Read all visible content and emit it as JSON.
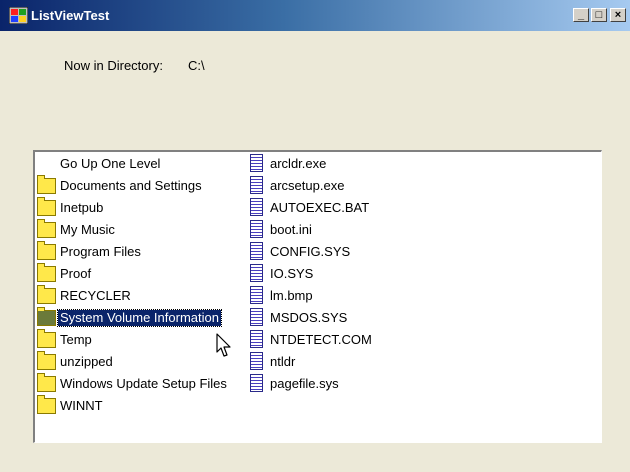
{
  "window": {
    "title": "ListViewTest",
    "controls": [
      "_",
      "□",
      "×"
    ]
  },
  "directory": {
    "label": "Now in Directory:",
    "value": "C:\\"
  },
  "list": {
    "left_column": [
      {
        "label": "Go Up One Level",
        "icon": "none"
      },
      {
        "label": "Documents and Settings",
        "icon": "folder-icon"
      },
      {
        "label": "Inetpub",
        "icon": "folder-icon"
      },
      {
        "label": "My Music",
        "icon": "folder-icon"
      },
      {
        "label": "Program Files",
        "icon": "folder-icon"
      },
      {
        "label": "Proof",
        "icon": "folder-icon"
      },
      {
        "label": "RECYCLER",
        "icon": "folder-icon"
      },
      {
        "label": "System Volume Information",
        "icon": "folder-icon",
        "selected": true
      },
      {
        "label": "Temp",
        "icon": "folder-icon"
      },
      {
        "label": "unzipped",
        "icon": "folder-icon"
      },
      {
        "label": "Windows Update Setup Files",
        "icon": "folder-icon"
      },
      {
        "label": "WINNT",
        "icon": "folder-icon"
      }
    ],
    "right_column": [
      {
        "label": "arcldr.exe",
        "icon": "file-icon"
      },
      {
        "label": "arcsetup.exe",
        "icon": "file-icon"
      },
      {
        "label": "AUTOEXEC.BAT",
        "icon": "file-icon"
      },
      {
        "label": "boot.ini",
        "icon": "file-icon"
      },
      {
        "label": "CONFIG.SYS",
        "icon": "file-icon"
      },
      {
        "label": "IO.SYS",
        "icon": "file-icon"
      },
      {
        "label": "lm.bmp",
        "icon": "file-icon"
      },
      {
        "label": "MSDOS.SYS",
        "icon": "file-icon"
      },
      {
        "label": "NTDETECT.COM",
        "icon": "file-icon"
      },
      {
        "label": "ntldr",
        "icon": "file-icon"
      },
      {
        "label": "pagefile.sys",
        "icon": "file-icon"
      }
    ]
  }
}
